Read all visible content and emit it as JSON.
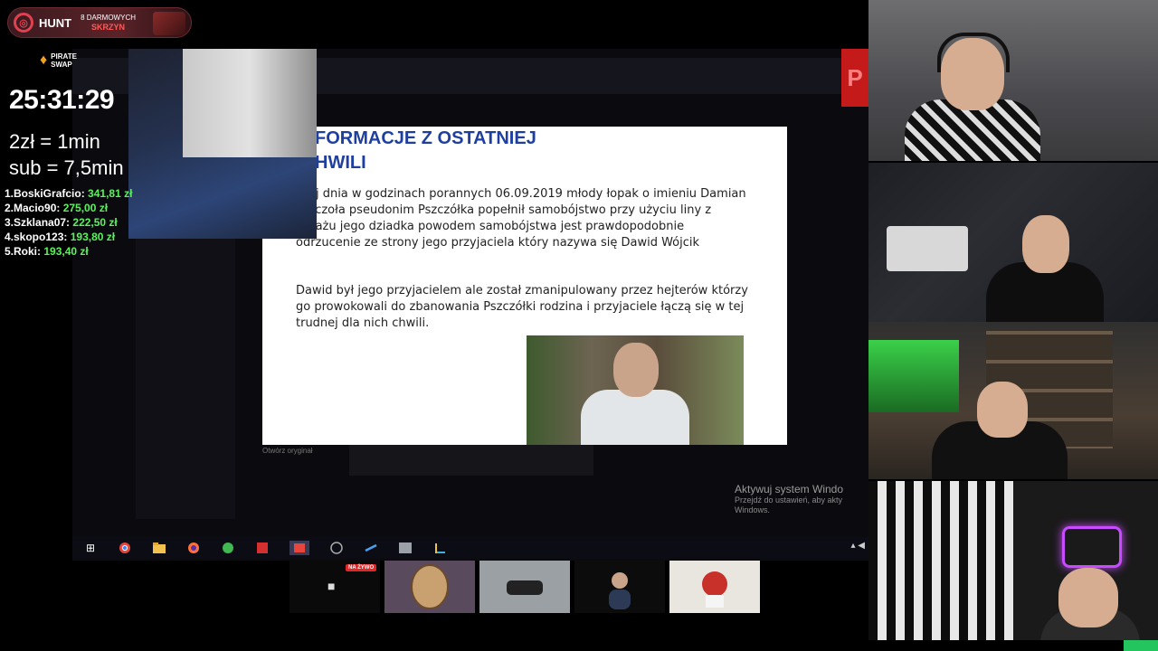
{
  "hunt_badge": {
    "name": "HUNT",
    "promo_line1": "8 DARMOWYCH",
    "promo_line2": "SKRZYN"
  },
  "pirate": {
    "line1": "PIRATE",
    "line2": "SWAP"
  },
  "timer": "25:31:29",
  "rates": {
    "zl": "2zł = 1min",
    "sub": "sub = 7,5min"
  },
  "leaderboard": [
    {
      "name": "1.BoskiGrafcio:",
      "amount": "341,81 zł"
    },
    {
      "name": "2.Macio90:",
      "amount": "275,00 zł"
    },
    {
      "name": "3.Szklana07:",
      "amount": "222,50 zł"
    },
    {
      "name": "4.skopo123:",
      "amount": "193,80 zł"
    },
    {
      "name": "5.Roki:",
      "amount": "193,40 zł"
    }
  ],
  "slide": {
    "title_line1": "FORMACJE Z OSTATNIEJ",
    "title_line2": "HWILI",
    "para1": "isiaj dnia w godzinach porannych 06.09.2019 młody łopak o imieniu Damian Pszczoła pseudonim Pszczółka popełnił samobójstwo przy użyciu liny z garażu jego dziadka powodem samobójstwa jest prawdopodobnie odrzucenie ze strony jego przyjaciela który nazywa się Dawid Wójcik",
    "para2": "Dawid był jego przyjacielem ale został zmanipulowany przez hejterów którzy go prowokowali do zbanowania Pszczółki rodzina i przyjaciele łączą się w tej trudnej dla nich chwili."
  },
  "open_original": "Otwórz oryginał",
  "activate": {
    "title": "Aktywuj system Windo",
    "sub": "Przejdź do ustawień, aby akty Windows."
  },
  "red_p": "P",
  "live_badge": "NA ŻYWO",
  "taskbar_icons": [
    "windows-start-icon",
    "chrome-icon",
    "folder-icon",
    "firefox-icon",
    "app-green-icon",
    "app-red-icon",
    "app-media-icon",
    "app-browser-icon",
    "steam-icon",
    "app-window-icon",
    "app-chart-icon"
  ]
}
